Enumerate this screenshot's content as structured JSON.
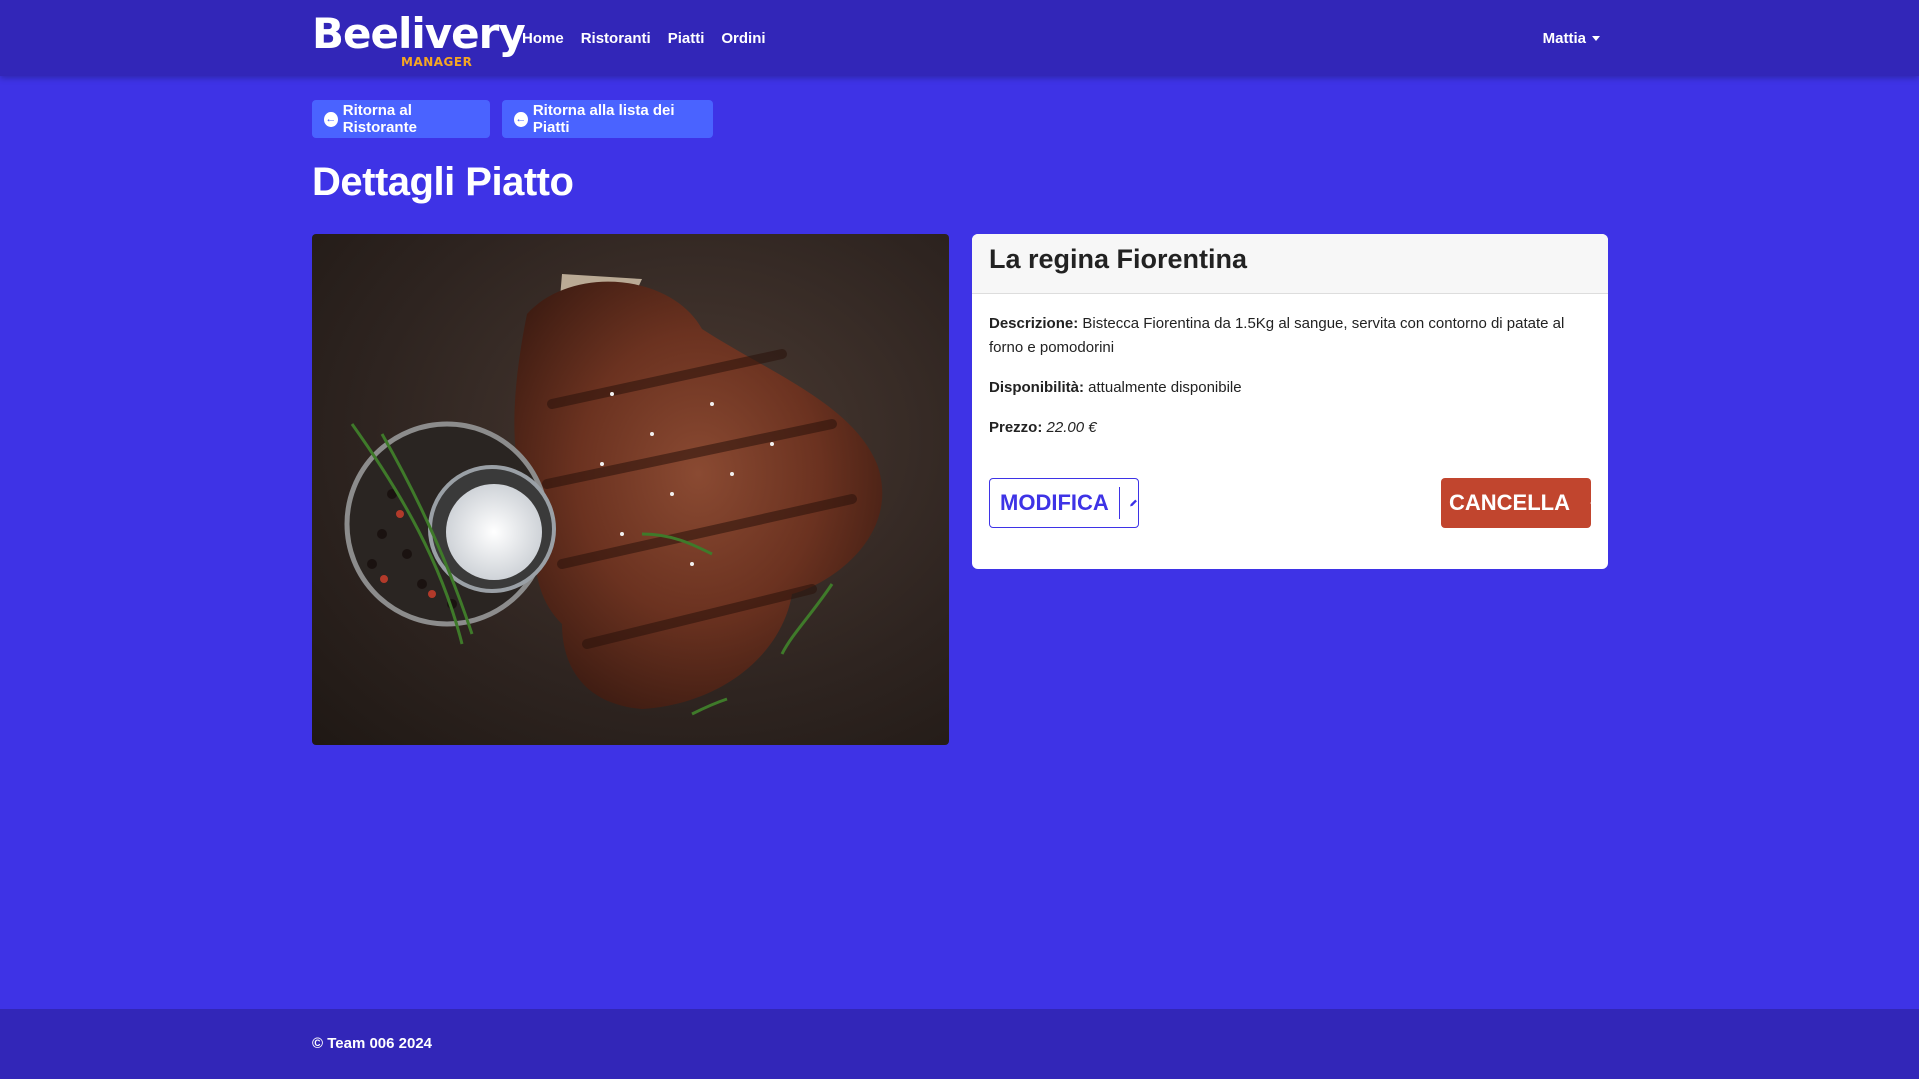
{
  "brand": {
    "logo_word": "Beelivery",
    "logo_sub": "MANAGER"
  },
  "nav": {
    "items": [
      {
        "label": "Home"
      },
      {
        "label": "Ristoranti"
      },
      {
        "label": "Piatti"
      },
      {
        "label": "Ordini"
      }
    ]
  },
  "user": {
    "name": "Mattia"
  },
  "actions": {
    "back_restaurant": "Ritorna al Ristorante",
    "back_dishes": "Ritorna alla lista dei Piatti"
  },
  "page": {
    "title": "Dettagli Piatto"
  },
  "dish": {
    "name": "La regina Fiorentina",
    "description_label": "Descrizione:",
    "description": "Bistecca Fiorentina da 1.5Kg al sangue, servita con contorno di patate al forno e pomodorini",
    "availability_label": "Disponibilità:",
    "availability": "attualmente disponibile",
    "price_label": "Prezzo:",
    "price": "22.00 €",
    "edit_label": "MODIFICA",
    "delete_label": "CANCELLA"
  },
  "footer": {
    "text": "© Team 006 2024"
  },
  "colors": {
    "background": "#3e33e6",
    "navbar": "#3226b8",
    "primary_button": "#4a63ff",
    "danger": "#c1452e",
    "logo_accent": "#f5a623"
  }
}
